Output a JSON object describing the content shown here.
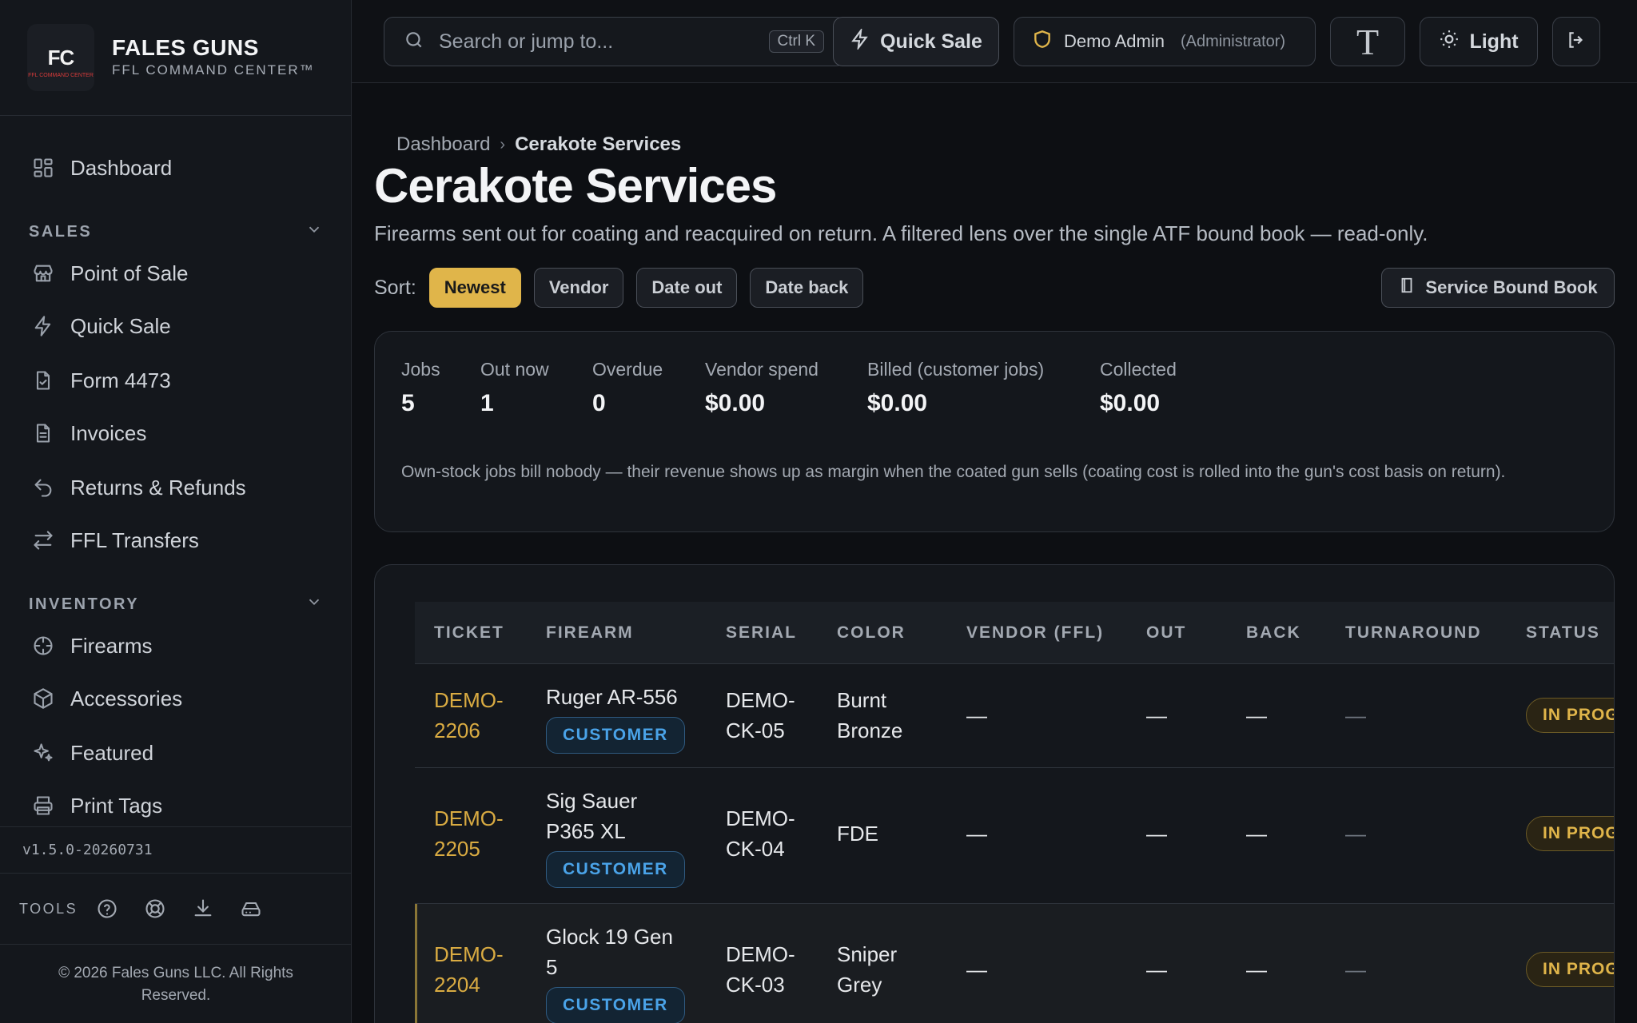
{
  "brand": {
    "name": "FALES GUNS",
    "subtitle": "FFL COMMAND CENTER™",
    "logo_text": "FC",
    "logo_small": "FFL COMMAND CENTER"
  },
  "sidebar": {
    "dashboard": "Dashboard",
    "sales_heading": "SALES",
    "sales_items": [
      "Point of Sale",
      "Quick Sale",
      "Form 4473",
      "Invoices",
      "Returns & Refunds",
      "FFL Transfers"
    ],
    "inventory_heading": "INVENTORY",
    "inventory_items": [
      "Firearms",
      "Accessories",
      "Featured",
      "Print Tags"
    ],
    "version": "v1.5.0-20260731",
    "tools_label": "TOOLS",
    "copyright": "© 2026 Fales Guns LLC. All Rights Reserved."
  },
  "topbar": {
    "search_placeholder": "Search or jump to...",
    "search_shortcut": "Ctrl K",
    "quick_sale": "Quick Sale",
    "user_name": "Demo Admin",
    "user_role": "(Administrator)",
    "font_toggle": "T",
    "theme_toggle": "Light"
  },
  "page": {
    "breadcrumb_root": "Dashboard",
    "breadcrumb_current": "Cerakote Services",
    "title": "Cerakote Services",
    "description": "Firearms sent out for coating and reacquired on return. A filtered lens over the single ATF bound book — read-only.",
    "sort_label": "Sort:",
    "sort_options": [
      "Newest",
      "Vendor",
      "Date out",
      "Date back"
    ],
    "sort_active": "Newest",
    "bound_book_button": "Service Bound Book"
  },
  "stats": {
    "items": [
      {
        "label": "Jobs",
        "value": "5"
      },
      {
        "label": "Out now",
        "value": "1"
      },
      {
        "label": "Overdue",
        "value": "0"
      },
      {
        "label": "Vendor spend",
        "value": "$0.00"
      },
      {
        "label": "Billed (customer jobs)",
        "value": "$0.00"
      },
      {
        "label": "Collected",
        "value": "$0.00"
      }
    ],
    "note": "Own-stock jobs bill nobody — their revenue shows up as margin when the coated gun sells (coating cost is rolled into the gun's cost basis on return)."
  },
  "table": {
    "columns": [
      "TICKET",
      "FIREARM",
      "SERIAL",
      "COLOR",
      "VENDOR (FFL)",
      "OUT",
      "BACK",
      "TURNAROUND",
      "STATUS"
    ],
    "rows": [
      {
        "ticket_a": "DEMO-",
        "ticket_b": "2206",
        "firearm_a": "Ruger AR-556",
        "firearm_b": "",
        "badge": "CUSTOMER",
        "serial_a": "DEMO-",
        "serial_b": "CK-05",
        "color_a": "Burnt",
        "color_b": "Bronze",
        "vendor": "—",
        "out": "—",
        "back": "—",
        "turnaround": "—",
        "status": "IN PROGRESS"
      },
      {
        "ticket_a": "DEMO-",
        "ticket_b": "2205",
        "firearm_a": "Sig Sauer",
        "firearm_b": "P365 XL",
        "badge": "CUSTOMER",
        "serial_a": "DEMO-",
        "serial_b": "CK-04",
        "color_a": "FDE",
        "color_b": "",
        "vendor": "—",
        "out": "—",
        "back": "—",
        "turnaround": "—",
        "status": "IN PROGRESS"
      },
      {
        "ticket_a": "DEMO-",
        "ticket_b": "2204",
        "firearm_a": "Glock 19 Gen",
        "firearm_b": "5",
        "badge": "CUSTOMER",
        "serial_a": "DEMO-",
        "serial_b": "CK-03",
        "color_a": "Sniper",
        "color_b": "Grey",
        "vendor": "—",
        "out": "—",
        "back": "—",
        "turnaround": "—",
        "status": "IN PROGRESS"
      }
    ]
  },
  "colors": {
    "accent": "#e0b54a",
    "badge_blue": "#4aa3e8",
    "bg": "#0d0f13"
  }
}
